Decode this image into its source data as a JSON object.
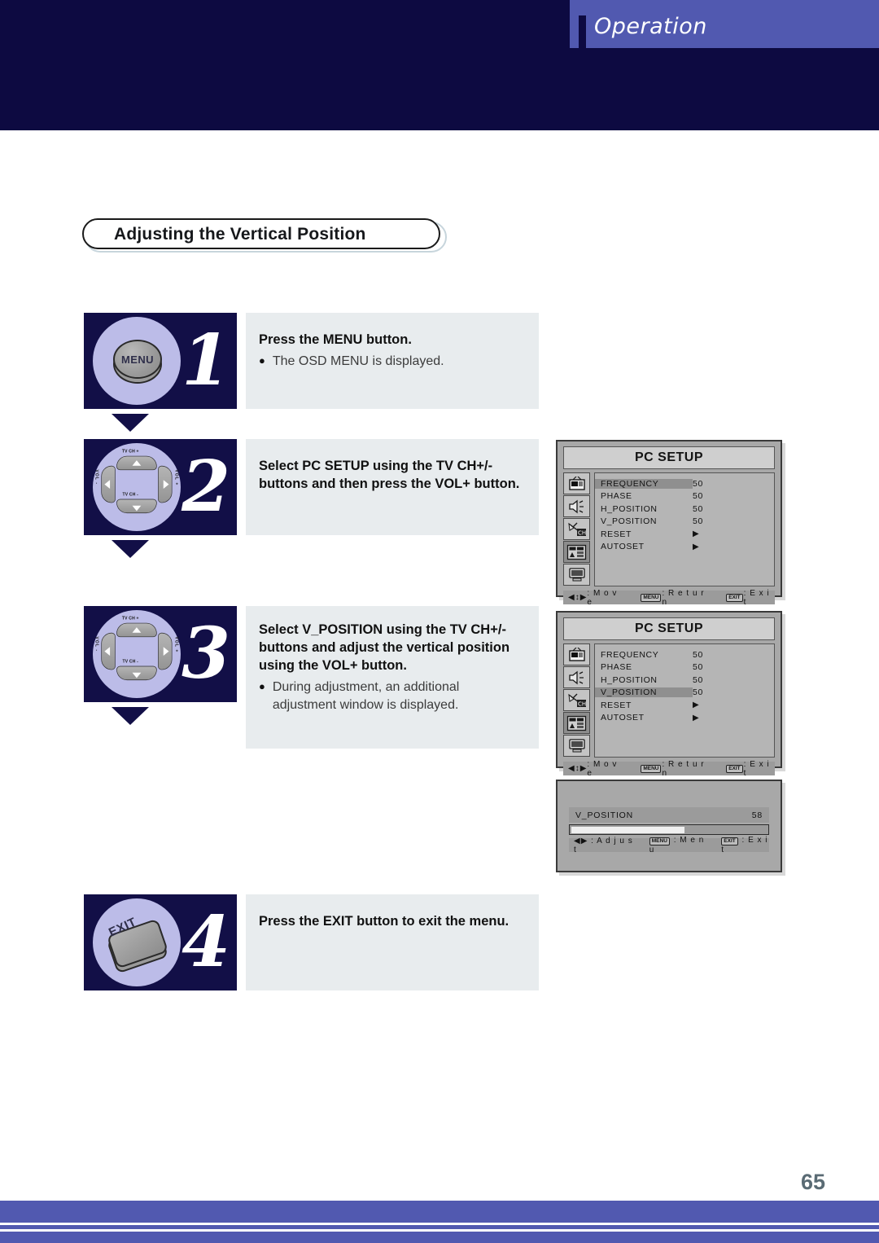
{
  "header": {
    "title": "Operation",
    "band_color": "#5159b0",
    "dark_color": "#0d0a41"
  },
  "section": {
    "title": "Adjusting the Vertical Position"
  },
  "steps": [
    {
      "number": "1",
      "icon": "menu-button",
      "button_label": "MENU",
      "heading": "Press the MENU button.",
      "bullets": [
        "The OSD MENU is displayed."
      ]
    },
    {
      "number": "2",
      "icon": "dpad",
      "heading": "Select PC SETUP using the TV CH+/- buttons and then press the VOL+ button.",
      "bullets": []
    },
    {
      "number": "3",
      "icon": "dpad",
      "heading": "Select V_POSITION using the TV CH+/- buttons and adjust the vertical position using the VOL+ button.",
      "bullets": [
        "During adjustment, an additional adjustment window is displayed."
      ]
    },
    {
      "number": "4",
      "icon": "exit-button",
      "button_label": "EXIT",
      "heading": "Press the EXIT button to exit the menu.",
      "bullets": []
    }
  ],
  "dpad": {
    "up_label": "TV CH +",
    "down_label": "TV CH -",
    "left_label": "VOL -",
    "right_label": "VOL +"
  },
  "osd_menus": [
    {
      "title": "PC SETUP",
      "selected": "FREQUENCY",
      "icons": [
        "tv-icon",
        "speaker-icon",
        "channel-icon",
        "setup-icon",
        "pc-icon"
      ],
      "active_icon_index": 3,
      "rows": [
        {
          "label": "FREQUENCY",
          "value": "50",
          "type": "value"
        },
        {
          "label": "PHASE",
          "value": "50",
          "type": "value"
        },
        {
          "label": "H_POSITION",
          "value": "50",
          "type": "value"
        },
        {
          "label": "V_POSITION",
          "value": "50",
          "type": "value"
        },
        {
          "label": "RESET",
          "value": "▶",
          "type": "submenu"
        },
        {
          "label": "AUTOSET",
          "value": "▶",
          "type": "submenu"
        }
      ],
      "footer": {
        "move_keys": "◀↕▶",
        "move_label": ": M o v e",
        "return_key": "MENU",
        "return_label": ": R e t u r n",
        "exit_key": "EXIT",
        "exit_label": ": E x i t"
      }
    },
    {
      "title": "PC SETUP",
      "selected": "V_POSITION",
      "icons": [
        "tv-icon",
        "speaker-icon",
        "channel-icon",
        "setup-icon",
        "pc-icon"
      ],
      "active_icon_index": 3,
      "rows": [
        {
          "label": "FREQUENCY",
          "value": "50",
          "type": "value"
        },
        {
          "label": "PHASE",
          "value": "50",
          "type": "value"
        },
        {
          "label": "H_POSITION",
          "value": "50",
          "type": "value"
        },
        {
          "label": "V_POSITION",
          "value": "50",
          "type": "value"
        },
        {
          "label": "RESET",
          "value": "▶",
          "type": "submenu"
        },
        {
          "label": "AUTOSET",
          "value": "▶",
          "type": "submenu"
        }
      ],
      "footer": {
        "move_keys": "◀↕▶",
        "move_label": ": M o v e",
        "return_key": "MENU",
        "return_label": ": R e t u r n",
        "exit_key": "EXIT",
        "exit_label": ": E x i t"
      }
    }
  ],
  "adjust_window": {
    "label": "V_POSITION",
    "value": "58",
    "fill_percent": 58,
    "footer": {
      "adjust_keys": "◀▶",
      "adjust_label": ": A d j u s t",
      "menu_key": "MENU",
      "menu_label": ": M e n u",
      "exit_key": "EXIT",
      "exit_label": ": E x i t"
    }
  },
  "footer": {
    "page_number": "65",
    "bar_color": "#5159b0"
  }
}
